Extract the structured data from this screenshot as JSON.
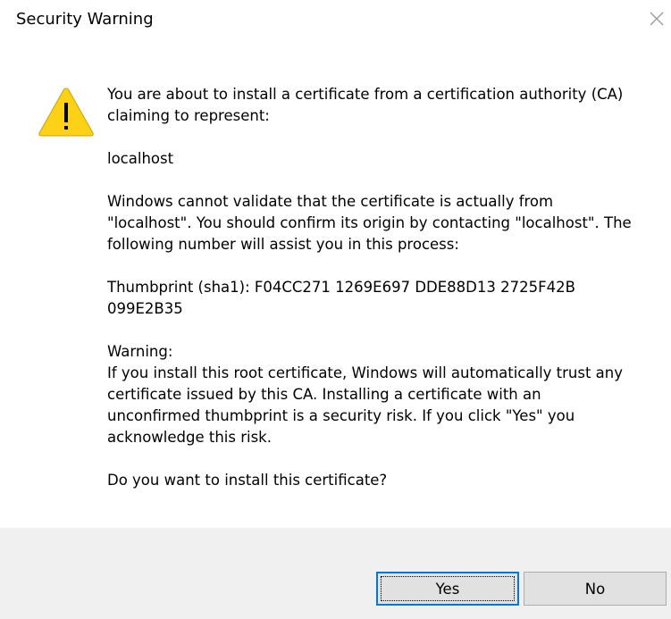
{
  "window": {
    "title": "Security Warning",
    "close_icon": "close-icon"
  },
  "icon": {
    "name": "warning-icon",
    "glyph": "!",
    "color": "#fcd116"
  },
  "message": {
    "intro": "You are about to install a certificate from a certification authority (CA) claiming to represent:",
    "subject": "localhost",
    "validation": "Windows cannot validate that the certificate is actually from \"localhost\". You should confirm its origin by contacting \"localhost\". The following number will assist you in this process:",
    "thumbprint": "Thumbprint (sha1): F04CC271 1269E697 DDE88D13 2725F42B 099E2B35",
    "warning_heading": "Warning:",
    "warning_text": "If you install this root certificate, Windows will automatically trust any certificate issued by this CA. Installing a certificate with an unconfirmed thumbprint is a security risk. If you click \"Yes\" you acknowledge this risk.",
    "question": "Do you want to install this certificate?"
  },
  "buttons": {
    "yes_label": "Yes",
    "no_label": "No"
  },
  "colors": {
    "accent": "#0078d7",
    "footer_bg": "#f0f0f0",
    "button_bg": "#e1e1e1"
  }
}
